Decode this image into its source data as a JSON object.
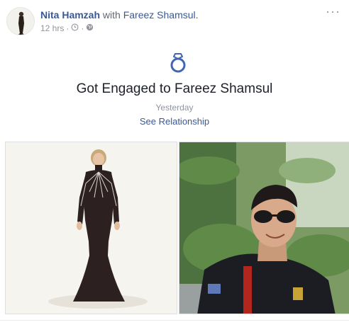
{
  "post": {
    "author": "Nita Hamzah",
    "with_word": "with",
    "tagged": "Fareez Shamsul.",
    "time": "12 hrs",
    "sep1": "·",
    "sep2": "·",
    "more_label": "···",
    "privacy_icon": "globe-icon",
    "time_icon": "clock-icon"
  },
  "event": {
    "icon": "ring-icon",
    "title": "Got Engaged to Fareez Shamsul",
    "date": "Yesterday",
    "link": "See Relationship",
    "accent": "#4267b2"
  },
  "colors": {
    "link": "#385898",
    "meta": "#90949c",
    "text": "#1d2129"
  }
}
